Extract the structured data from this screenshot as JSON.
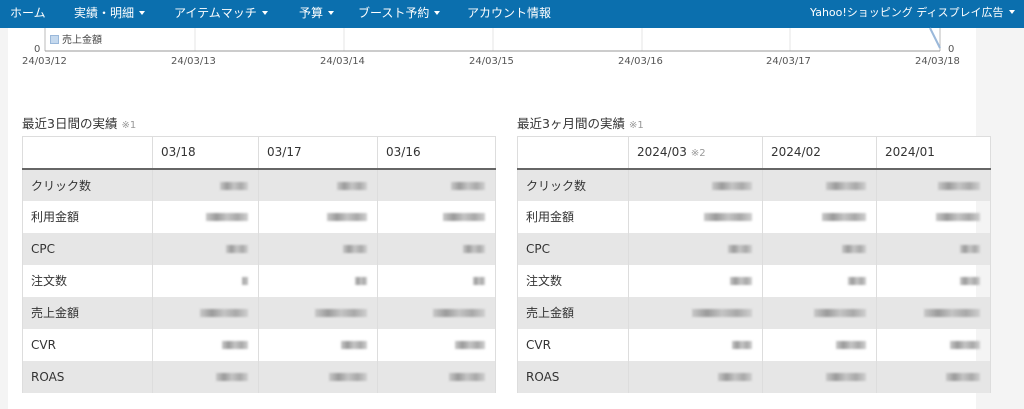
{
  "nav": {
    "items": [
      {
        "label": "ホーム",
        "dropdown": false
      },
      {
        "label": "実績・明細",
        "dropdown": true
      },
      {
        "label": "アイテムマッチ",
        "dropdown": true
      },
      {
        "label": "予算",
        "dropdown": true
      },
      {
        "label": "ブースト予約",
        "dropdown": true
      },
      {
        "label": "アカウント情報",
        "dropdown": false
      }
    ],
    "account": "Yahoo!ショッピング ディスプレイ広告"
  },
  "chart": {
    "legend": "売上金額",
    "left_zero": "0",
    "right_zero": "0",
    "x_ticks": [
      "24/03/12",
      "24/03/13",
      "24/03/14",
      "24/03/15",
      "24/03/16",
      "24/03/17",
      "24/03/18"
    ]
  },
  "daily": {
    "title": "最近3日間の実績",
    "note": "※1",
    "columns": [
      "03/18",
      "03/17",
      "03/16"
    ],
    "rows": [
      "クリック数",
      "利用金額",
      "CPC",
      "注文数",
      "売上金額",
      "CVR",
      "ROAS"
    ]
  },
  "monthly": {
    "title": "最近3ヶ月間の実績",
    "note": "※1",
    "columns": [
      "2024/03",
      "2024/02",
      "2024/01"
    ],
    "first_col_note": "※2",
    "rows": [
      "クリック数",
      "利用金額",
      "CPC",
      "注文数",
      "売上金額",
      "CVR",
      "ROAS"
    ]
  },
  "colors": {
    "nav_bg": "#0b6fae",
    "alt_row": "#e6e6e6",
    "page_bg": "#f4f4f4"
  }
}
